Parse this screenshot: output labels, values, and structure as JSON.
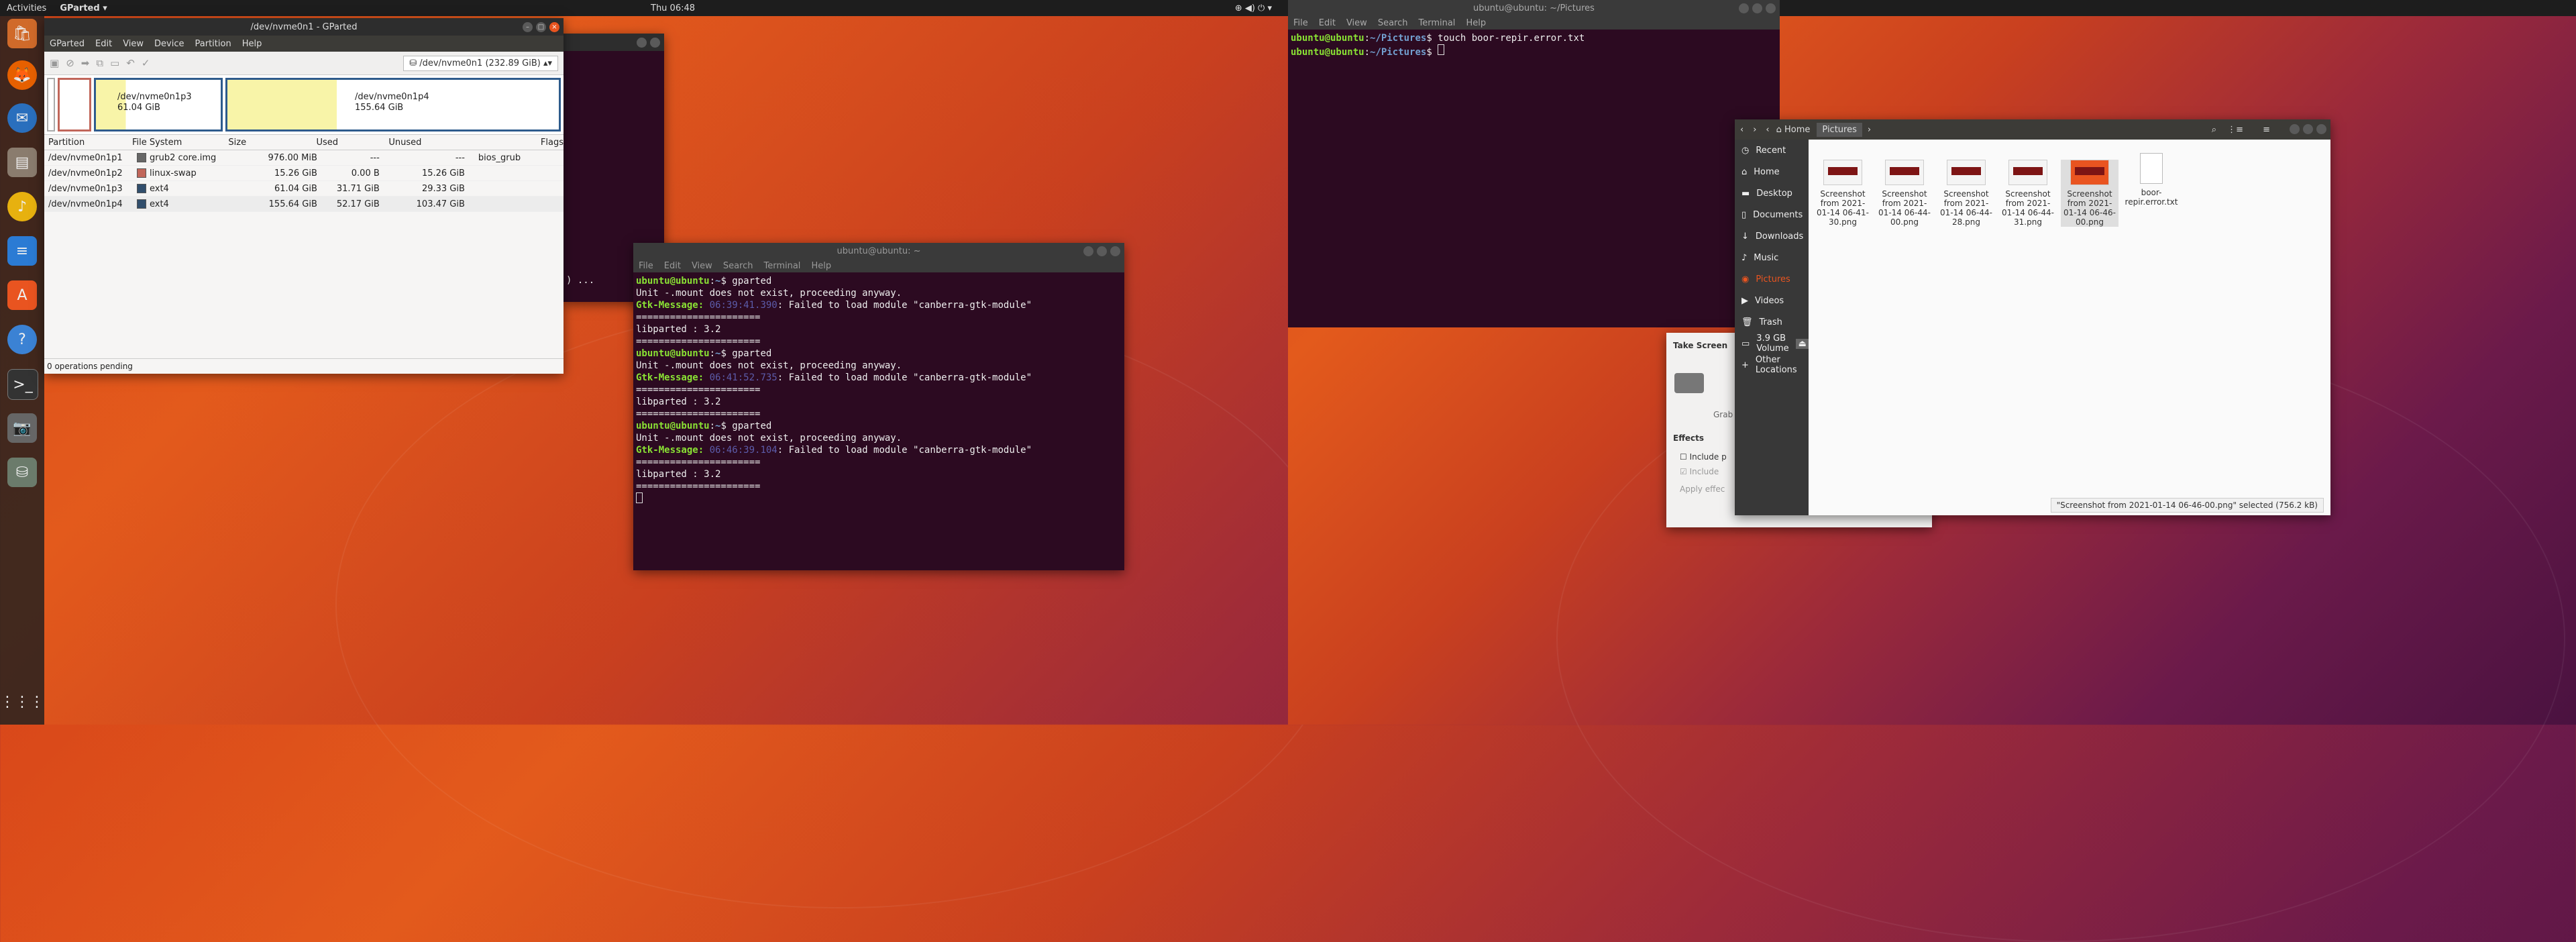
{
  "topbar": {
    "activities": "Activities",
    "app_menu": "GParted ▾",
    "clock": "Thu 06:48",
    "clock2": "Thu 06:48"
  },
  "gparted": {
    "title": "/dev/nvme0n1 - GParted",
    "menu": [
      "GParted",
      "Edit",
      "View",
      "Device",
      "Partition",
      "Help"
    ],
    "device_selector": "/dev/nvme0n1  (232.89 GiB)",
    "map": [
      {
        "name": "/dev/nvme0n1p3",
        "size": "61.04 GiB"
      },
      {
        "name": "/dev/nvme0n1p4",
        "size": "155.64 GiB"
      }
    ],
    "columns": [
      "Partition",
      "File System",
      "Size",
      "Used",
      "Unused",
      "Flags"
    ],
    "rows": [
      {
        "partition": "/dev/nvme0n1p1",
        "fs": "grub2 core.img",
        "fs_color": "#666666",
        "size": "976.00 MiB",
        "used": "---",
        "unused": "---",
        "flags": "bios_grub"
      },
      {
        "partition": "/dev/nvme0n1p2",
        "fs": "linux-swap",
        "fs_color": "#c1665a",
        "size": "15.26 GiB",
        "used": "0.00 B",
        "unused": "15.26 GiB",
        "flags": ""
      },
      {
        "partition": "/dev/nvme0n1p3",
        "fs": "ext4",
        "fs_color": "#314e6c",
        "size": "61.04 GiB",
        "used": "31.71 GiB",
        "unused": "29.33 GiB",
        "flags": ""
      },
      {
        "partition": "/dev/nvme0n1p4",
        "fs": "ext4",
        "fs_color": "#314e6c",
        "size": "155.64 GiB",
        "used": "52.17 GiB",
        "unused": "103.47 GiB",
        "flags": ""
      }
    ],
    "status": "0 operations pending"
  },
  "terminal1": {
    "title": "ubuntu@ubuntu: ~",
    "menu": [
      "File",
      "Edit",
      "View",
      "Search",
      "Terminal",
      "Help"
    ],
    "blocks": [
      {
        "prompt": "ubuntu@ubuntu",
        "path": "~",
        "cmd": "$ gparted",
        "l1": "Unit -.mount does not exist, proceeding anyway.",
        "gtk": "Gtk-Message:",
        "time": "06:39:41.390",
        "msg": ": Failed to load module \"canberra-gtk-module\"",
        "sep": "======================",
        "lib": "libparted : 3.2"
      },
      {
        "prompt": "ubuntu@ubuntu",
        "path": "~",
        "cmd": "$ gparted",
        "l1": "Unit -.mount does not exist, proceeding anyway.",
        "gtk": "Gtk-Message:",
        "time": "06:41:52.735",
        "msg": ": Failed to load module \"canberra-gtk-module\"",
        "sep": "======================",
        "lib": "libparted : 3.2"
      },
      {
        "prompt": "ubuntu@ubuntu",
        "path": "~",
        "cmd": "$ gparted",
        "l1": "Unit -.mount does not exist, proceeding anyway.",
        "gtk": "Gtk-Message:",
        "time": "06:46:39.104",
        "msg": ": Failed to load module \"canberra-gtk-module\"",
        "sep": "======================",
        "lib": "libparted : 3.2"
      }
    ],
    "behind_text": ") ..."
  },
  "terminal2": {
    "title": "ubuntu@ubuntu: ~/Pictures",
    "menu": [
      "File",
      "Edit",
      "View",
      "Search",
      "Terminal",
      "Help"
    ],
    "line1_prompt": "ubuntu@ubuntu",
    "line1_path": "~/Pictures",
    "line1_cmd": "$ touch boor-repir.error.txt",
    "line2_prompt": "ubuntu@ubuntu",
    "line2_path": "~/Pictures",
    "line2_cmd": "$ "
  },
  "files": {
    "path_home": "Home",
    "path_current": "Pictures",
    "sidebar": [
      "Recent",
      "Home",
      "Desktop",
      "Documents",
      "Downloads",
      "Music",
      "Pictures",
      "Videos",
      "Trash",
      "3.9 GB Volume",
      "Other Locations"
    ],
    "items": [
      {
        "name": "Screenshot from 2021-01-14 06-41-30.png"
      },
      {
        "name": "Screenshot from 2021-01-14 06-44-00.png"
      },
      {
        "name": "Screenshot from 2021-01-14 06-44-28.png"
      },
      {
        "name": "Screenshot from 2021-01-14 06-44-31.png"
      },
      {
        "name": "Screenshot from 2021-01-14 06-46-00.png"
      },
      {
        "name": "boor-repir.error.txt"
      }
    ],
    "status": "\"Screenshot from 2021-01-14 06-46-00.png\" selected  (756.2 kB)"
  },
  "screenshot_dialog": {
    "take_label": "Take Screen",
    "grab": "Grab",
    "effects": "Effects",
    "include1": "Include p",
    "include2": "Include",
    "apply": "Apply effec"
  }
}
